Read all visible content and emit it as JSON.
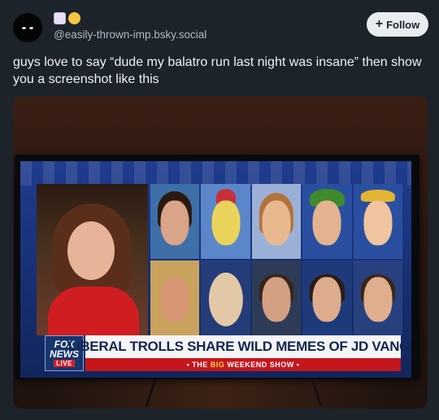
{
  "author": {
    "avatar_icon": "dark-creature-avatar-icon",
    "display_name_emojis": [
      "kawaii-face-emoji-icon",
      "scared-face-emoji-icon"
    ],
    "handle": "@easily-thrown-imp.bsky.social"
  },
  "follow_button": {
    "icon": "plus-icon",
    "label": "Follow"
  },
  "post": {
    "text": "guys love to say “dude my balatro run last night was insane” then show you a screenshot like this"
  },
  "tv": {
    "network_logo_line1": "FOX",
    "network_logo_line2": "NEWS",
    "network_logo_live": "LIVE",
    "headline": "LIBERAL TROLLS SHARE WILD MEMES OF JD VANCE",
    "show_prefix": "• THE ",
    "show_big": "BIG",
    "show_suffix": " WEEKEND SHOW •"
  },
  "colors": {
    "background": "#1d232b",
    "follow_button_bg": "#e9edf1",
    "headline_text": "#13264f",
    "fox_red": "#c4161c"
  }
}
